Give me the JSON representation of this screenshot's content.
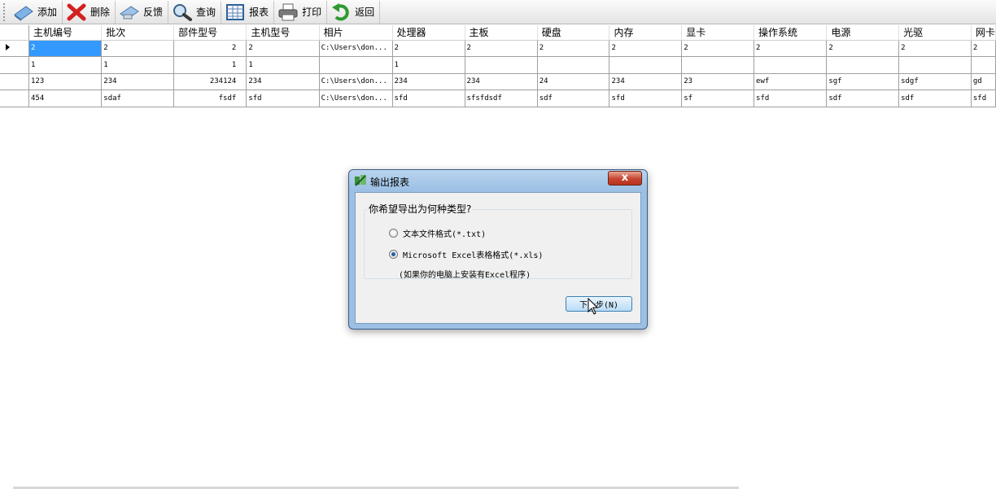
{
  "toolbar": {
    "buttons": [
      {
        "label": "添加",
        "icon": "add-icon"
      },
      {
        "label": "删除",
        "icon": "delete-icon"
      },
      {
        "label": "反馈",
        "icon": "feedback-icon"
      },
      {
        "label": "查询",
        "icon": "search-icon"
      },
      {
        "label": "报表",
        "icon": "report-icon"
      },
      {
        "label": "打印",
        "icon": "print-icon"
      },
      {
        "label": "返回",
        "icon": "back-icon"
      }
    ]
  },
  "grid": {
    "columns": [
      "主机编号",
      "批次",
      "部件型号",
      "主机型号",
      "相片",
      "处理器",
      "主板",
      "硬盘",
      "内存",
      "显卡",
      "操作系统",
      "电源",
      "光驱",
      "网卡"
    ],
    "rows": [
      [
        "2",
        "2",
        "2",
        "2",
        "C:\\Users\\don...",
        "2",
        "2",
        "2",
        "2",
        "2",
        "2",
        "2",
        "2",
        "2"
      ],
      [
        "1",
        "1",
        "1",
        "1",
        "",
        "1",
        "",
        "",
        "",
        "",
        "",
        "",
        "",
        ""
      ],
      [
        "123",
        "234",
        "234124",
        "234",
        "C:\\Users\\don...",
        "234",
        "234",
        "24",
        "234",
        "23",
        "ewf",
        "sgf",
        "sdgf",
        "gd"
      ],
      [
        "454",
        "sdaf",
        "fsdf",
        "sfd",
        "C:\\Users\\don...",
        "sfd",
        "sfsfdsdf",
        "sdf",
        "sfd",
        "sf",
        "sfd",
        "sdf",
        "sdf",
        "sfd"
      ]
    ]
  },
  "dialog": {
    "title": "输出报表",
    "close_label": "x",
    "group_label": "你希望导出为何种类型?",
    "options": [
      {
        "label": "文本文件格式(*.txt)",
        "selected": false
      },
      {
        "label": "Microsoft Excel表格格式(*.xls)",
        "selected": true
      }
    ],
    "note": "(如果你的电脑上安装有Excel程序)",
    "next_label": "下一步(N)"
  }
}
